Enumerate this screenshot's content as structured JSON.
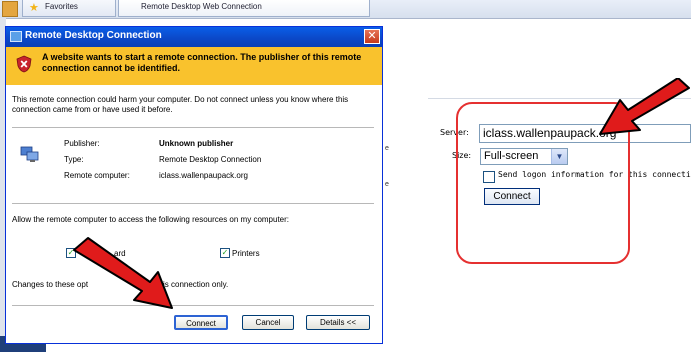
{
  "browser": {
    "tabs": [
      {
        "label": "Favorites"
      },
      {
        "label": "Remote Desktop Web Connection"
      }
    ]
  },
  "dialog": {
    "title": "Remote Desktop Connection",
    "warning": "A website wants to start a remote connection. The publisher of this remote connection cannot be identified.",
    "intro": "This remote connection could harm your computer. Do not connect unless you know where this connection came from or have used it before.",
    "details": [
      {
        "label": "Publisher:",
        "value": "Unknown publisher"
      },
      {
        "label": "Type:",
        "value": "Remote Desktop Connection"
      },
      {
        "label": "Remote computer:",
        "value": "iclass.wallenpaupack.org"
      }
    ],
    "resources_prompt": "Allow the remote computer to access the following resources on my computer:",
    "resources": [
      {
        "label": "ard",
        "checked": true
      },
      {
        "label": "Printers",
        "checked": true
      }
    ],
    "changes_note_left": "Changes to these opt",
    "changes_note_right": "is connection only.",
    "buttons": {
      "connect": "Connect",
      "cancel": "Cancel",
      "details": "Details <<"
    }
  },
  "page": {
    "left_letters": [
      "e",
      "e"
    ],
    "server_label": "Server:",
    "server_value": "iclass.wallenpaupack.org",
    "size_label": "Size:",
    "size_value": "Full-screen",
    "logon_label": "Send logon information for this connection",
    "connect_label": "Connect"
  },
  "colors": {
    "arrow": "#e01b1b",
    "callout": "#e53030",
    "warning_band": "#f9c22d",
    "titlebar": "#0b49c9"
  }
}
